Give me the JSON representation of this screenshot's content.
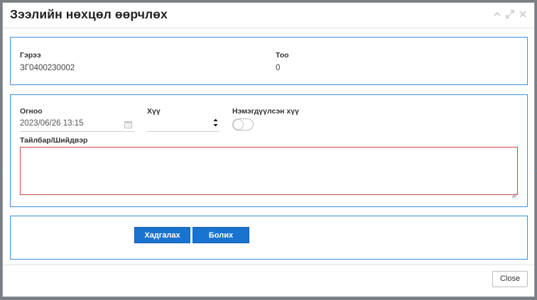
{
  "dialog": {
    "title": "Зээлийн нөхцөл өөрчлөх",
    "header_icons": [
      "chevron-up-icon",
      "expand-icon",
      "close-x-icon"
    ]
  },
  "contract_panel": {
    "contract_label": "Гэрээ",
    "contract_value": "ЗГ0400230002",
    "count_label": "Тоо",
    "count_value": "0"
  },
  "form_panel": {
    "date_label": "Огноо",
    "date_value": "2023/06/26 13:15",
    "rate_label": "Хүү",
    "rate_value": "",
    "added_rate_label": "Нэмэгдүүлсэн хүү",
    "added_rate_toggle": false,
    "note_label": "Тайлбар/Шийдвэр",
    "note_value": ""
  },
  "actions": {
    "save_label": "Хадгалах",
    "cancel_label": "Болих"
  },
  "footer": {
    "close_label": "Close"
  },
  "colors": {
    "accent": "#1a73cf",
    "panel_border": "#3b8fdc",
    "error_border": "#d04646"
  }
}
